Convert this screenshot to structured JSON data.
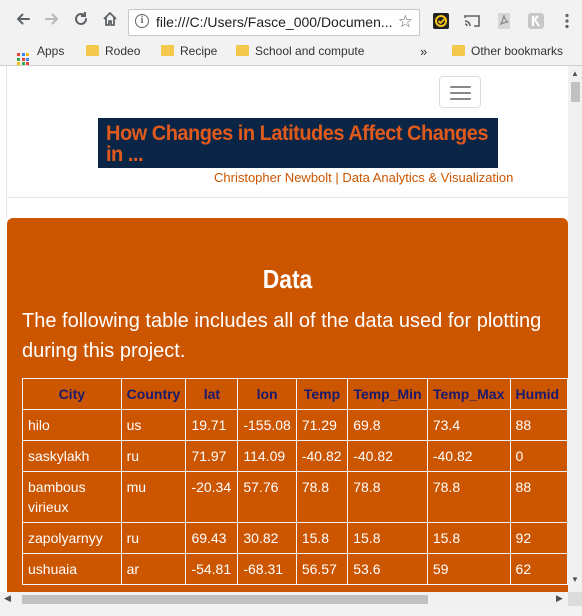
{
  "browser": {
    "url": "file:///C:/Users/Fasce_000/Documen...",
    "bookmarks": [
      "Apps",
      "Rodeo",
      "Recipe",
      "School and compute"
    ],
    "overflow": "»",
    "other_bookmarks": "Other bookmarks"
  },
  "site": {
    "banner_title": "How Changes in Latitudes Affect Changes in ...",
    "byline": "Christopher Newbolt | Data Analytics & Visualization"
  },
  "panel": {
    "title": "Data",
    "description": "The following table includes all of the data used for plotting during this project."
  },
  "table": {
    "headers": [
      "City",
      "Country",
      "lat",
      "lon",
      "Temp",
      "Temp_Min",
      "Temp_Max",
      "Humid"
    ],
    "rows": [
      [
        "hilo",
        "us",
        "19.71",
        "-155.08",
        "71.29",
        "69.8",
        "73.4",
        "88"
      ],
      [
        "saskylakh",
        "ru",
        "71.97",
        "114.09",
        "-40.82",
        "-40.82",
        "-40.82",
        "0"
      ],
      [
        "bambous virieux",
        "mu",
        "-20.34",
        "57.76",
        "78.8",
        "78.8",
        "78.8",
        "88"
      ],
      [
        "zapolyarnyy",
        "ru",
        "69.43",
        "30.82",
        "15.8",
        "15.8",
        "15.8",
        "92"
      ],
      [
        "ushuaia",
        "ar",
        "-54.81",
        "-68.31",
        "56.57",
        "53.6",
        "59",
        "62"
      ]
    ]
  },
  "colors": {
    "accent": "#cc5500",
    "banner_bg": "#0b2547",
    "banner_text": "#e05a1b",
    "header_text": "#1a1a6e"
  }
}
